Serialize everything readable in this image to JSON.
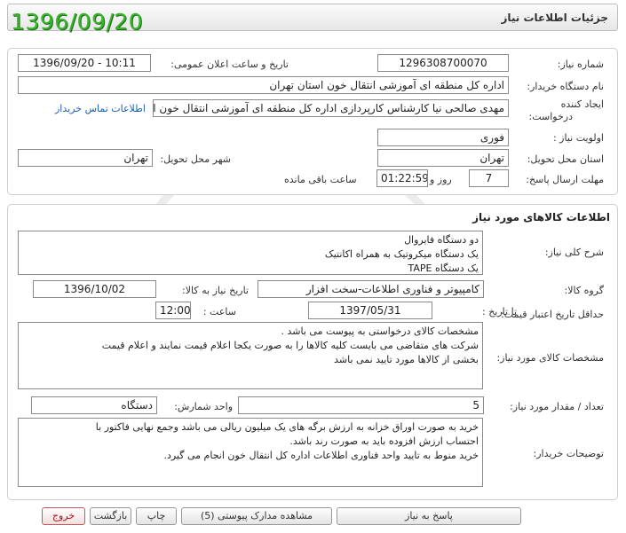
{
  "window_title": "جزئیات اطلاعات نیاز",
  "date_stamp": "1396/09/20",
  "watermark": "هزاره",
  "fields": {
    "need_number_label": "شماره نیاز:",
    "need_number": "1296308700070",
    "announce_label": "تاریخ و ساعت اعلان عمومی:",
    "announce_value": "1396/09/20 - 10:11",
    "buyer_org_label": "نام دستگاه خریدار:",
    "buyer_org": "اداره کل منطقه ای آموزشی انتقال خون استان تهران",
    "creator_label_1": "ایجاد کننده",
    "creator_label_2": "درخواست:",
    "creator": "مهدی صالحی نیا کارشناس کارپردازی اداره کل منطقه ای آموزشی انتقال خون استان تهران",
    "contact_link": "اطلاعات تماس خریدار",
    "priority_label": "اولویت نیاز :",
    "priority": "فوری",
    "province_label": "استان محل تحویل:",
    "province": "تهران",
    "city_label": "شهر محل تحویل:",
    "city": "تهران",
    "deadline_label": "مهلت ارسال پاسخ:",
    "days_value": "7",
    "days_word": "روز و",
    "time_value": "01:22:59",
    "remaining_word": "ساعت باقی مانده"
  },
  "goods": {
    "section_title": "اطلاعات کالاهای مورد نیاز",
    "summary_label": "شرح کلی نیاز:",
    "summary_lines": [
      "دو دستگاه فایروال",
      "یک دستگاه میکروتیک به همراه اکانتیک",
      "یک دستگاه TAPE"
    ],
    "group_label": "گروه کالا:",
    "group_value": "کامپیوتر و فناوری اطلاعات-سخت افزار",
    "need_date_label": "تاریخ نیاز به کالا:",
    "need_date": "1396/10/02",
    "validity_label": "حداقل تاریخ اعتبار قیمت:",
    "until_label": "تا تاریخ :",
    "until_date": "1397/05/31",
    "hour_label": "ساعت :",
    "hour_value": "12:00",
    "specs_label": "مشخصات کالای مورد نیاز:",
    "specs_lines": [
      "مشخصات کالای درخواستی به پیوست می باشد .",
      "شرکت های متقاضی می بایست کلیه کالاها را به صورت یکجا اعلام قیمت نمایند و اعلام قیمت",
      "بخشی از کالاها مورد تایید نمی باشد"
    ],
    "qty_label": "تعداد / مقدار مورد نیاز:",
    "qty_value": "5",
    "unit_label": "واحد شمارش:",
    "unit_value": "دستگاه",
    "notes_label": "توضیحات خریدار:",
    "notes_lines": [
      "خرید به صورت اوراق خزانه به ارزش برگه های یک میلیون ریالی می باشد وجمع نهایی فاکتور با",
      "احتساب ارزش افزوده باید به صورت رند باشد.",
      "خرید منوط به تایید واحد فناوری اطلاعات اداره کل انتقال خون انجام می گیرد."
    ]
  },
  "buttons": {
    "reply": "پاسخ به نیاز",
    "attachments": "مشاهده مدارک پیوستی (5)",
    "print": "چاپ",
    "back": "بازگشت",
    "exit": "خروج"
  },
  "colors": {
    "stamp": "#3bb52e",
    "exit": "#a11111",
    "link": "#1a5fb4"
  }
}
